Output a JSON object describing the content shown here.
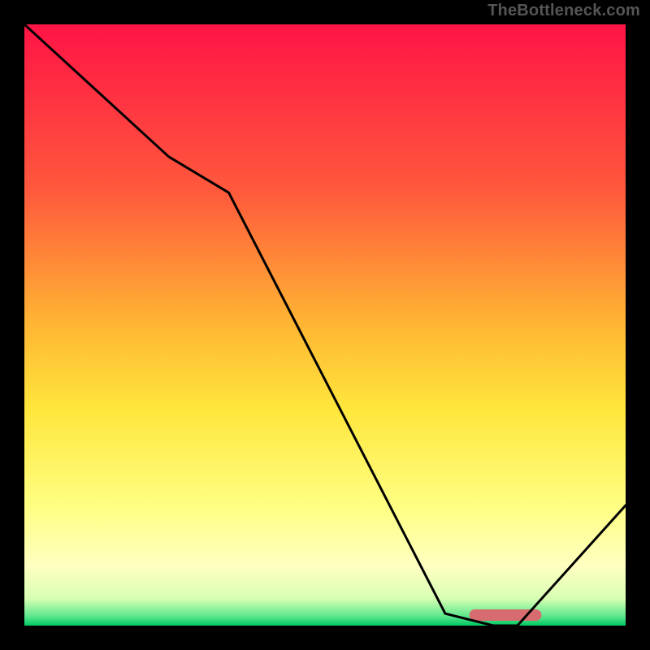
{
  "watermark": "TheBottleneck.com",
  "chart_data": {
    "type": "line",
    "title": "",
    "xlabel": "",
    "ylabel": "",
    "xlim": [
      0,
      100
    ],
    "ylim": [
      0,
      100
    ],
    "x": [
      0,
      24,
      34,
      70,
      78,
      82,
      100
    ],
    "values": [
      100,
      78,
      72,
      2,
      0,
      0,
      20
    ],
    "optimum_range_x": [
      74,
      86
    ],
    "gradient_stops": [
      {
        "offset": 0.0,
        "color": "#ff1446"
      },
      {
        "offset": 0.28,
        "color": "#ff5a3c"
      },
      {
        "offset": 0.5,
        "color": "#ffb633"
      },
      {
        "offset": 0.64,
        "color": "#ffe63c"
      },
      {
        "offset": 0.8,
        "color": "#ffff82"
      },
      {
        "offset": 0.9,
        "color": "#ffffc0"
      },
      {
        "offset": 0.955,
        "color": "#d8ffb4"
      },
      {
        "offset": 0.985,
        "color": "#5ae68c"
      },
      {
        "offset": 1.0,
        "color": "#00c864"
      }
    ]
  }
}
